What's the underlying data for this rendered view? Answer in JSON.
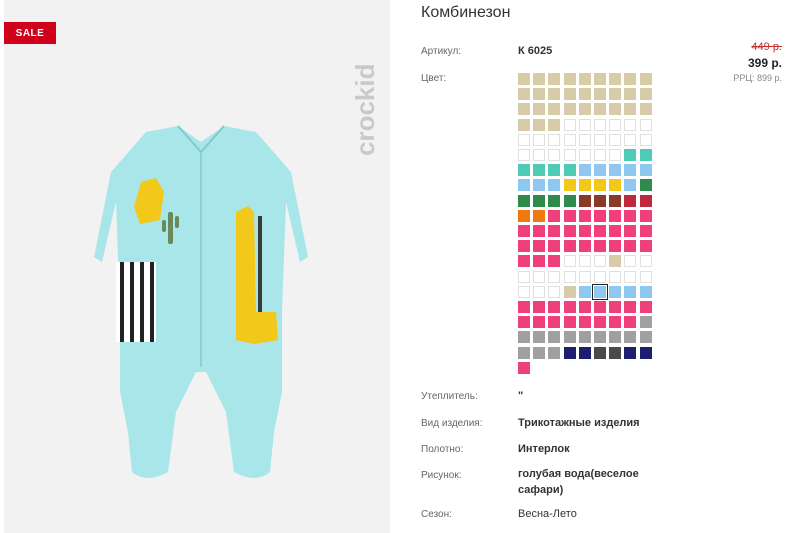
{
  "badge": "SALE",
  "brand": "crockid",
  "product": {
    "title": "Комбинезон",
    "article_label": "Артикул:",
    "article_value": "К 6025",
    "color_label": "Цвет:",
    "old_price": "449 р.",
    "price": "399 р.",
    "rrp": "РРЦ: 899 р.",
    "insulation_label": "Утеплитель:",
    "insulation_value": "\"",
    "type_label": "Вид изделия:",
    "type_value": "Трикотажные изделия",
    "fabric_label": "Полотно:",
    "fabric_value": "Интерлок",
    "pattern_label": "Рисунок:",
    "pattern_value": "голубая вода(веселое сафари)",
    "season_label": "Сезон:",
    "season_value": "Весна-Лето"
  },
  "colors": {
    "beige": "#d8cba8",
    "white": "#ffffff",
    "teal": "#4ecbb5",
    "lightblue": "#8ec8f0",
    "yellow": "#f2c81a",
    "green": "#2e8b4a",
    "brown": "#8a3a2a",
    "red": "#c0283a",
    "orange": "#f07a10",
    "pink": "#f0407a",
    "gray": "#a0a0a0",
    "darkgray": "#4a4a4a",
    "navy": "#1e1e6e",
    "sale": "#d0021b",
    "garment": "#a9e6ea"
  },
  "swatch_rows": [
    [
      "beige",
      "beige",
      "beige",
      "beige",
      "beige",
      "beige",
      "beige",
      "beige",
      "beige"
    ],
    [
      "beige",
      "beige",
      "beige",
      "beige",
      "beige",
      "beige",
      "beige",
      "beige",
      "beige"
    ],
    [
      "beige",
      "beige",
      "beige",
      "beige",
      "beige",
      "beige",
      "beige",
      "beige",
      "beige"
    ],
    [
      "beige",
      "beige",
      "beige",
      "white",
      "white",
      "white",
      "white",
      "white",
      "white"
    ],
    [
      "white",
      "white",
      "white",
      "white",
      "white",
      "white",
      "white",
      "white",
      "white"
    ],
    [
      "white",
      "white",
      "white",
      "white",
      "white",
      "white",
      "white",
      "teal",
      "teal"
    ],
    [
      "teal",
      "teal",
      "teal",
      "teal",
      "lightblue",
      "lightblue",
      "lightblue",
      "lightblue",
      "lightblue"
    ],
    [
      "lightblue",
      "lightblue",
      "lightblue",
      "yellow",
      "yellow",
      "yellow",
      "yellow",
      "lightblue",
      "green"
    ],
    [
      "green",
      "green",
      "green",
      "green",
      "brown",
      "brown",
      "brown",
      "red",
      "red"
    ],
    [
      "orange",
      "orange",
      "pink",
      "pink",
      "pink",
      "pink",
      "pink",
      "pink",
      "pink"
    ],
    [
      "pink",
      "pink",
      "pink",
      "pink",
      "pink",
      "pink",
      "pink",
      "pink",
      "pink"
    ],
    [
      "pink",
      "pink",
      "pink",
      "pink",
      "pink",
      "pink",
      "pink",
      "pink",
      "pink"
    ],
    [
      "pink",
      "pink",
      "pink",
      "white",
      "white",
      "white",
      "beige",
      "white",
      "white"
    ],
    [
      "white",
      "white",
      "white",
      "white",
      "white",
      "white",
      "white",
      "white",
      "white"
    ],
    [
      "white",
      "white",
      "white",
      "beige",
      "lightblue",
      "lightblue",
      "lightblue",
      "lightblue",
      "lightblue"
    ],
    [
      "pink",
      "pink",
      "pink",
      "pink",
      "pink",
      "pink",
      "pink",
      "pink",
      "pink"
    ],
    [
      "pink",
      "pink",
      "pink",
      "pink",
      "pink",
      "pink",
      "pink",
      "pink",
      "gray"
    ],
    [
      "gray",
      "gray",
      "gray",
      "gray",
      "gray",
      "gray",
      "gray",
      "gray",
      "gray"
    ],
    [
      "gray",
      "gray",
      "gray",
      "navy",
      "navy",
      "darkgray",
      "darkgray",
      "navy",
      "navy"
    ],
    [
      "pink"
    ]
  ],
  "selected_swatch": [
    14,
    5
  ]
}
